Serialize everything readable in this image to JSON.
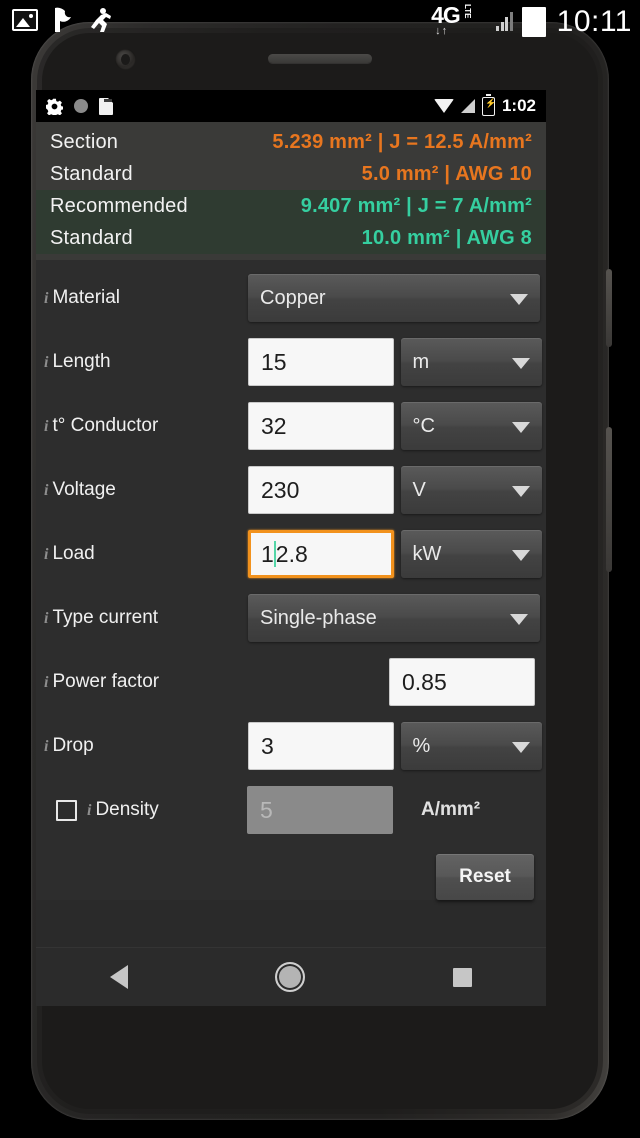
{
  "os_statusbar": {
    "icons": [
      "screenshot-image-icon",
      "flag-icon",
      "activity-run-icon"
    ],
    "network_label": "4G",
    "network_sub": "LTE",
    "data_arrows": "↓↑",
    "clock": "10:11"
  },
  "device_status": {
    "left_icons": [
      "gear-icon",
      "circle-dot-icon",
      "sd-card-icon"
    ],
    "right_icons": [
      "wifi-icon",
      "signal-icon",
      "battery-charging-icon"
    ],
    "battery_glyph": "⚡",
    "clock": "1:02"
  },
  "results": {
    "rows": [
      {
        "label": "Section",
        "value": "5.239 mm² | J = 12.5 A/mm²",
        "color": "orange"
      },
      {
        "label": "Standard",
        "value": "5.0 mm² | AWG 10",
        "color": "orange"
      },
      {
        "label": "Recommended",
        "value": "9.407 mm² | J = 7 A/mm²",
        "color": "teal"
      },
      {
        "label": "Standard",
        "value": "10.0 mm² | AWG 8",
        "color": "teal"
      }
    ],
    "colors": {
      "orange": "#e8761f",
      "teal": "#35cfa0",
      "green_bg": "#2f3b31",
      "panel_bg": "#3a3a38"
    }
  },
  "form": {
    "info_marker": "i",
    "material": {
      "label": "Material",
      "value": "Copper"
    },
    "length": {
      "label": "Length",
      "value": "15",
      "unit": "m"
    },
    "conductor": {
      "label": "t° Conductor",
      "value": "32",
      "unit": "°C"
    },
    "voltage": {
      "label": "Voltage",
      "value": "230",
      "unit": "V"
    },
    "load": {
      "label": "Load",
      "value_before_caret": "1",
      "value_after_caret": "2.8",
      "unit": "kW",
      "focused": true
    },
    "type_current": {
      "label": "Type current",
      "value": "Single-phase"
    },
    "power_factor": {
      "label": "Power factor",
      "value": "0.85"
    },
    "drop": {
      "label": "Drop",
      "value": "3",
      "unit": "%"
    },
    "density": {
      "label": "Density",
      "checked": false,
      "value": "5",
      "unit": "A/mm²"
    },
    "reset_label": "Reset"
  },
  "navbar": {
    "back": "back-icon",
    "home": "home-icon",
    "recents": "recents-icon"
  }
}
